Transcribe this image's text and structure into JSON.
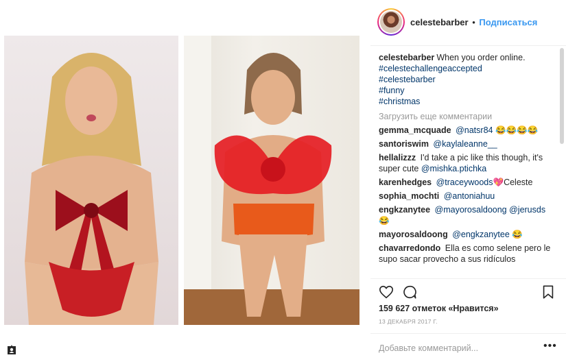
{
  "post": {
    "username": "celestebarber",
    "separator": "•",
    "follow_label": "Подписаться",
    "caption": {
      "username": "celestebarber",
      "text": "When you order online.",
      "hashtags": [
        "#celestechallengeaccepted",
        "#celestebarber",
        "#funny",
        "#christmas"
      ]
    },
    "load_more_label": "Загрузить еще комментарии",
    "comments": [
      {
        "user": "gemma_mcquade",
        "mention": "@natsr84",
        "text": "",
        "emoji": "😂😂😂😂"
      },
      {
        "user": "santoriswim",
        "mention": "@kaylaleanne__",
        "text": "",
        "emoji": ""
      },
      {
        "user": "hellalizzz",
        "mention": "",
        "text": "I'd take a pic like this though, it's super cute",
        "mention_after": "@mishka.ptichka"
      },
      {
        "user": "karenhedges",
        "mention": "@traceywoods",
        "text": "Celeste",
        "emoji": "💖"
      },
      {
        "user": "sophia_mochti",
        "mention": "@antoniahuu",
        "text": "",
        "emoji": ""
      },
      {
        "user": "engkzanytee",
        "mention": "@mayorosaldoong @jerusds",
        "text": "",
        "emoji": "😂"
      },
      {
        "user": "mayorosaldoong",
        "mention": "@engkzanytee",
        "text": "",
        "emoji": "😂"
      },
      {
        "user": "chavarredondo",
        "mention": "",
        "text": "Ella es como selene pero le supo sacar provecho a sus ridículos",
        "emoji": ""
      }
    ],
    "likes_text": "159 627 отметок «Нравится»",
    "date_text": "13 ДЕКАБРЯ 2017 Г.",
    "add_comment_placeholder": "Добавьте комментарий...",
    "more_label": "•••"
  },
  "icons": {
    "like": "heart-icon",
    "comment": "comment-icon",
    "save": "bookmark-icon",
    "tag": "user-tag-icon"
  },
  "colors": {
    "link": "#003569",
    "follow": "#3897f0",
    "muted": "#999999"
  }
}
